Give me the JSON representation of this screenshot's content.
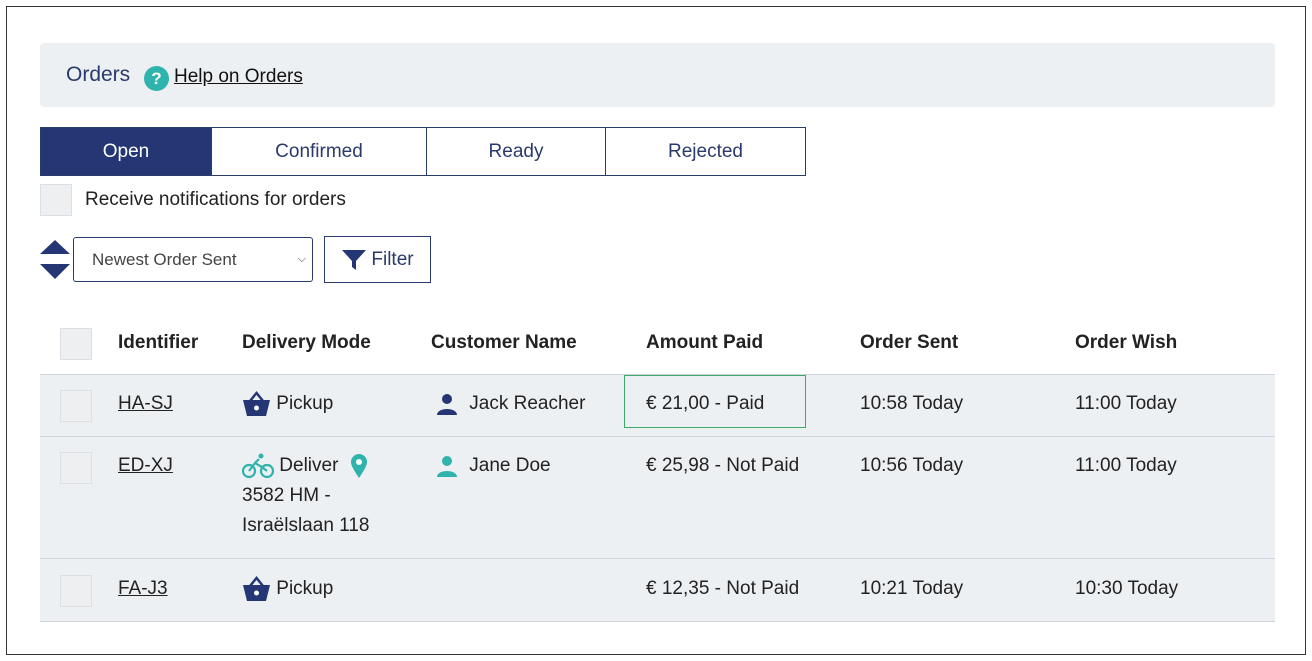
{
  "header": {
    "title": "Orders",
    "help_link": "Help on Orders"
  },
  "tabs": [
    {
      "label": "Open",
      "active": true
    },
    {
      "label": "Confirmed",
      "active": false
    },
    {
      "label": "Ready",
      "active": false
    },
    {
      "label": "Rejected",
      "active": false
    }
  ],
  "notifications": {
    "label": "Receive notifications for orders"
  },
  "sort": {
    "selected": "Newest Order Sent"
  },
  "filter": {
    "label": "Filter"
  },
  "table": {
    "columns": [
      "Identifier",
      "Delivery Mode",
      "Customer Name",
      "Amount Paid",
      "Order Sent",
      "Order Wish"
    ],
    "rows": [
      {
        "identifier": "HA-SJ",
        "delivery_mode": "Pickup",
        "address_line1": "",
        "address_line2": "",
        "customer": "Jack Reacher",
        "amount": "€ 21,00 - Paid",
        "order_sent": "10:58 Today",
        "order_wish": "11:00 Today"
      },
      {
        "identifier": "ED-XJ",
        "delivery_mode": "Deliver",
        "address_line1": "3582 HM -",
        "address_line2": "Israëlslaan 118",
        "customer": "Jane Doe",
        "amount": "€ 25,98 - Not Paid",
        "order_sent": "10:56 Today",
        "order_wish": "11:00 Today"
      },
      {
        "identifier": "FA-J3",
        "delivery_mode": "Pickup",
        "address_line1": "",
        "address_line2": "",
        "customer": "",
        "amount": "€ 12,35 - Not Paid",
        "order_sent": "10:21 Today",
        "order_wish": "10:30 Today"
      }
    ]
  },
  "colors": {
    "primary": "#243673",
    "accent": "#2fb3ad",
    "paid_border": "#3ea96b",
    "row_bg": "#edf0f3"
  },
  "icons": {
    "help": "question-circle-icon",
    "sort": "sort-arrows-icon",
    "filter": "funnel-icon",
    "pickup": "basket-icon",
    "deliver": "bicycle-icon",
    "location": "map-pin-icon",
    "customer": "person-icon"
  }
}
